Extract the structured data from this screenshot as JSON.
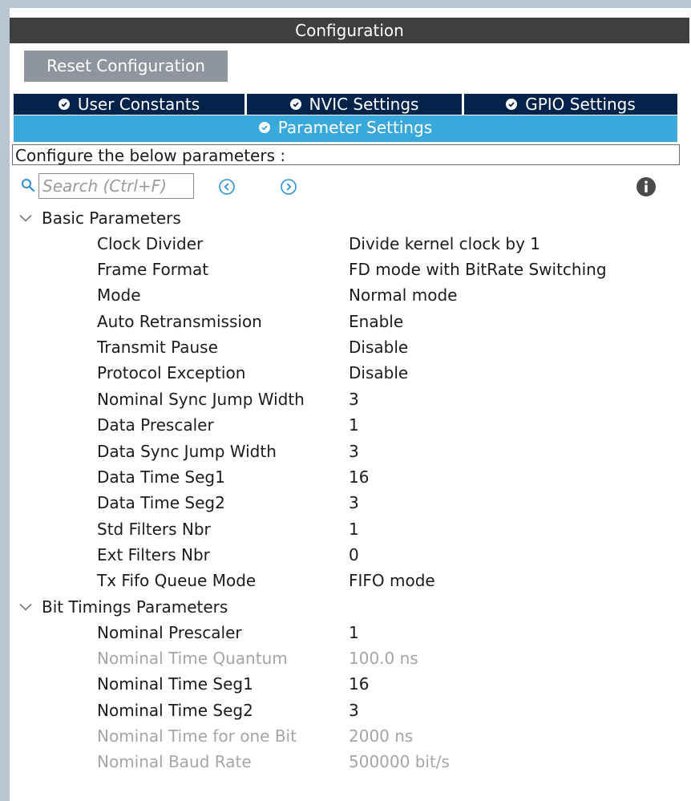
{
  "header": {
    "title": "Configuration"
  },
  "toolbar": {
    "reset_label": "Reset Configuration"
  },
  "tabs": [
    {
      "label": "User Constants"
    },
    {
      "label": "NVIC Settings"
    },
    {
      "label": "GPIO Settings"
    },
    {
      "label": "Parameter Settings"
    }
  ],
  "configure_text": "Configure the below parameters :",
  "search": {
    "placeholder": "Search (Ctrl+F)"
  },
  "sections": [
    {
      "title": "Basic Parameters",
      "params": [
        {
          "name": "Clock Divider",
          "value": "Divide kernel clock by 1",
          "enabled": true
        },
        {
          "name": "Frame Format",
          "value": "FD mode with BitRate Switching",
          "enabled": true
        },
        {
          "name": "Mode",
          "value": "Normal mode",
          "enabled": true
        },
        {
          "name": "Auto Retransmission",
          "value": "Enable",
          "enabled": true
        },
        {
          "name": "Transmit Pause",
          "value": "Disable",
          "enabled": true
        },
        {
          "name": "Protocol Exception",
          "value": "Disable",
          "enabled": true
        },
        {
          "name": "Nominal Sync Jump Width",
          "value": "3",
          "enabled": true
        },
        {
          "name": "Data Prescaler",
          "value": "1",
          "enabled": true
        },
        {
          "name": "Data Sync Jump Width",
          "value": "3",
          "enabled": true
        },
        {
          "name": "Data Time Seg1",
          "value": "16",
          "enabled": true
        },
        {
          "name": "Data Time Seg2",
          "value": "3",
          "enabled": true
        },
        {
          "name": "Std Filters Nbr",
          "value": "1",
          "enabled": true
        },
        {
          "name": "Ext Filters Nbr",
          "value": "0",
          "enabled": true
        },
        {
          "name": "Tx Fifo Queue Mode",
          "value": "FIFO mode",
          "enabled": true
        }
      ]
    },
    {
      "title": "Bit Timings Parameters",
      "params": [
        {
          "name": "Nominal Prescaler",
          "value": "1",
          "enabled": true
        },
        {
          "name": "Nominal Time Quantum",
          "value": "100.0 ns",
          "enabled": false
        },
        {
          "name": "Nominal Time Seg1",
          "value": "16",
          "enabled": true
        },
        {
          "name": "Nominal Time Seg2",
          "value": "3",
          "enabled": true
        },
        {
          "name": "Nominal Time for one Bit",
          "value": "2000 ns",
          "enabled": false
        },
        {
          "name": "Nominal Baud Rate",
          "value": "500000 bit/s",
          "enabled": false
        }
      ]
    }
  ],
  "colors": {
    "title_bar": "#3e3f40",
    "tab_dark": "#03234b",
    "tab_active": "#39a9db",
    "reset_button": "#8e959c",
    "disabled_text": "#a3a6a9"
  }
}
